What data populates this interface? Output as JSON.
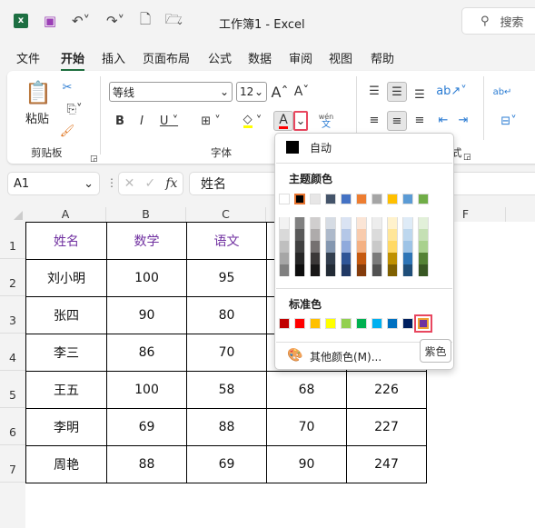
{
  "titlebar": {
    "title": "工作簿1  -  Excel",
    "search_placeholder": "搜索",
    "app_icon": "excel-icon",
    "icons": [
      "save-icon",
      "undo-icon",
      "redo-icon",
      "new-file-icon",
      "open-folder-icon",
      "customize-icon"
    ]
  },
  "tabs": [
    "文件",
    "开始",
    "插入",
    "页面布局",
    "公式",
    "数据",
    "审阅",
    "视图",
    "帮助"
  ],
  "active_tab": "开始",
  "ribbon": {
    "paste": "粘贴",
    "clipboard_group": "剪贴板",
    "font_group": "字体",
    "align_group": "齐方式",
    "font_name": "等线",
    "font_size": "12",
    "bold": "B",
    "italic": "I",
    "underline": "U",
    "font_color_letter": "A",
    "phonetic_top": "wén",
    "phonetic_bottom": "文",
    "font_color": "#ff0000",
    "fill_color": "#ffff00"
  },
  "formula_bar": {
    "name_box": "A1",
    "fx": "fx",
    "value": "姓名"
  },
  "columns": [
    "A",
    "B",
    "C",
    "D",
    "E",
    "F"
  ],
  "rows": [
    "1",
    "2",
    "3",
    "4",
    "5",
    "6",
    "7"
  ],
  "table": [
    [
      "姓名",
      "数学",
      "语文",
      "",
      ""
    ],
    [
      "刘小明",
      "100",
      "95",
      "",
      ""
    ],
    [
      "张四",
      "90",
      "80",
      "",
      ""
    ],
    [
      "李三",
      "86",
      "70",
      "",
      ""
    ],
    [
      "王五",
      "100",
      "58",
      "68",
      "226"
    ],
    [
      "李明",
      "69",
      "88",
      "70",
      "227"
    ],
    [
      "周艳",
      "88",
      "69",
      "90",
      "247"
    ]
  ],
  "header_color": "#7030a0",
  "color_menu": {
    "auto": "自动",
    "theme_label": "主题颜色",
    "theme": [
      "#ffffff",
      "#000000",
      "#e7e6e6",
      "#44546a",
      "#4472c4",
      "#ed7d31",
      "#a5a5a5",
      "#ffc000",
      "#5b9bd5",
      "#70ad47"
    ],
    "shades": [
      [
        "#f2f2f2",
        "#d9d9d9",
        "#bfbfbf",
        "#a6a6a6",
        "#808080"
      ],
      [
        "#808080",
        "#595959",
        "#404040",
        "#262626",
        "#0d0d0d"
      ],
      [
        "#d0cece",
        "#aeabab",
        "#757171",
        "#3b3838",
        "#181717"
      ],
      [
        "#d6dce4",
        "#adb9ca",
        "#8497b0",
        "#333f4f",
        "#222b35"
      ],
      [
        "#dae3f3",
        "#b4c7e7",
        "#8faadc",
        "#2f5597",
        "#203864"
      ],
      [
        "#fbe5d6",
        "#f8cbad",
        "#f4b183",
        "#c55a11",
        "#843c0c"
      ],
      [
        "#ededed",
        "#dbdbdb",
        "#c9c9c9",
        "#7b7b7b",
        "#525252"
      ],
      [
        "#fff2cc",
        "#ffe699",
        "#ffd966",
        "#bf9000",
        "#7f6000"
      ],
      [
        "#deebf7",
        "#bdd7ee",
        "#9dc3e6",
        "#2e75b6",
        "#1f4e79"
      ],
      [
        "#e2f0d9",
        "#c5e0b4",
        "#a9d18e",
        "#548235",
        "#385723"
      ]
    ],
    "standard_label": "标准色",
    "standard": [
      "#c00000",
      "#ff0000",
      "#ffc000",
      "#ffff00",
      "#92d050",
      "#00b050",
      "#00b0f0",
      "#0070c0",
      "#002060",
      "#7030a0"
    ],
    "more": "其他颜色(M)...",
    "tooltip": "紫色"
  }
}
